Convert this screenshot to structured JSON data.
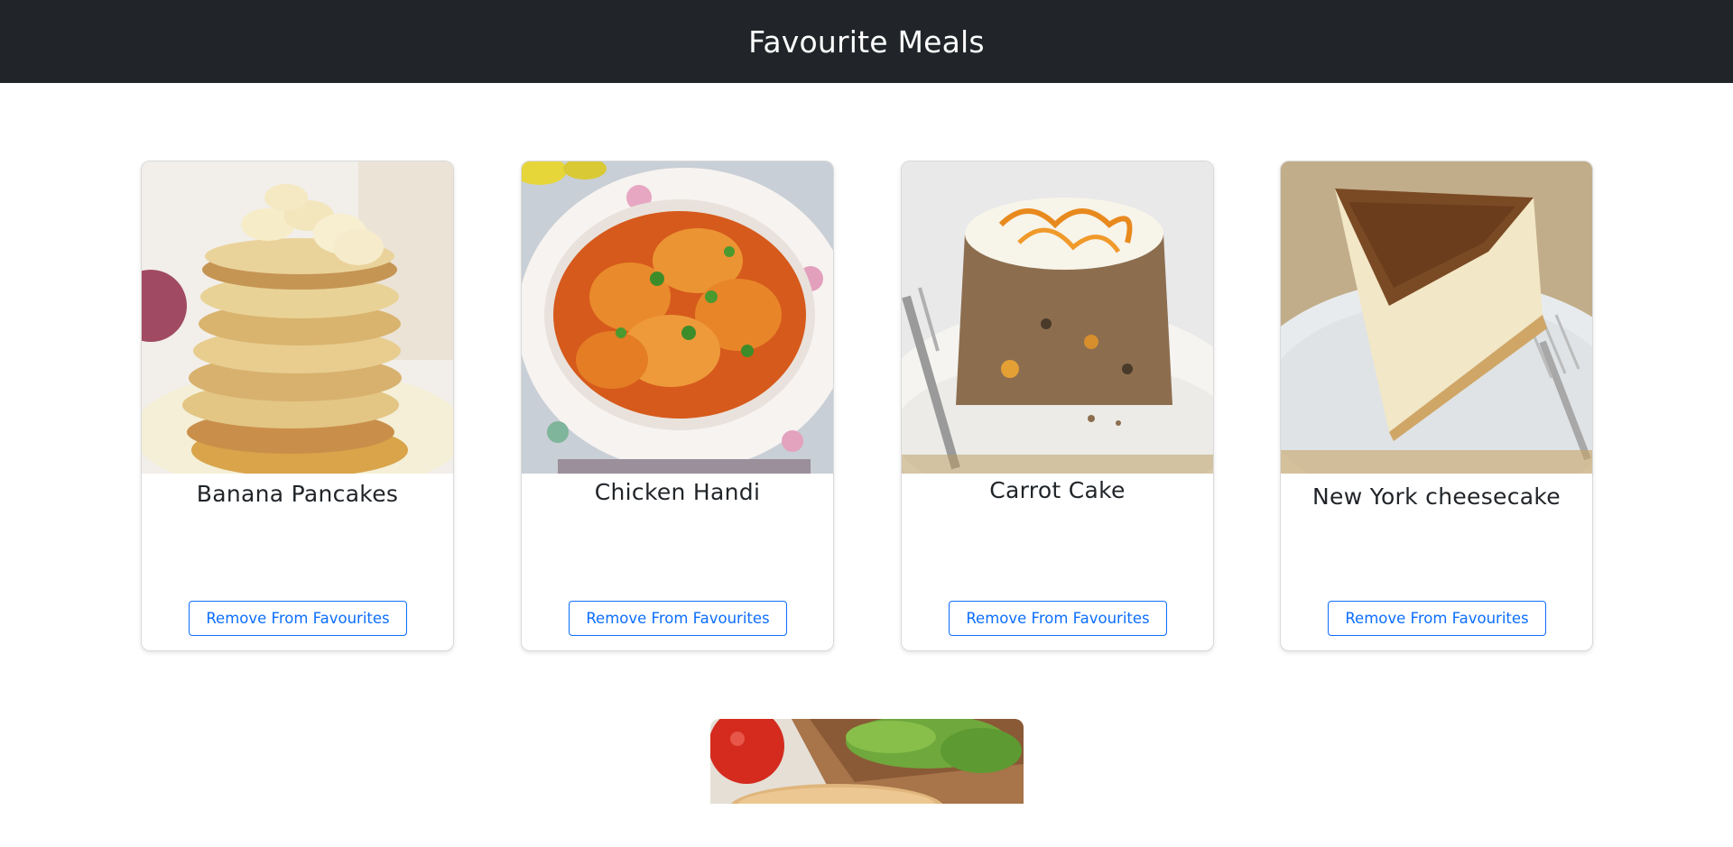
{
  "header": {
    "title": "Favourite Meals"
  },
  "meals": [
    {
      "name": "Banana Pancakes",
      "button_label": "Remove From Favourites"
    },
    {
      "name": "Chicken Handi",
      "button_label": "Remove From Favourites"
    },
    {
      "name": "Carrot Cake",
      "button_label": "Remove From Favourites"
    },
    {
      "name": "New York cheesecake",
      "button_label": "Remove From Favourites"
    }
  ],
  "colors": {
    "header_bg": "#212529",
    "accent": "#0d6efd",
    "text": "#212529"
  }
}
